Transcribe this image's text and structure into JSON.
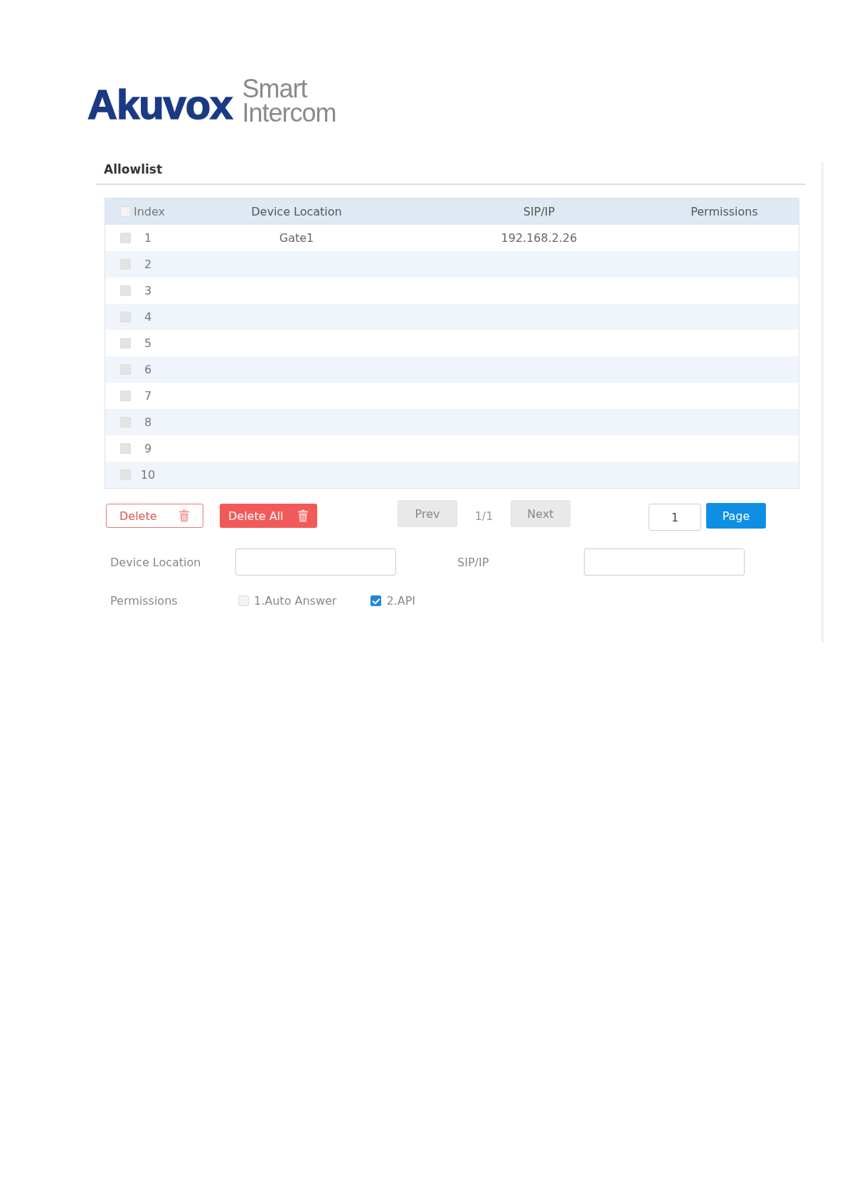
{
  "logo": {
    "brand": "Akuvox",
    "tagline": [
      "Smart",
      "Intercom"
    ]
  },
  "title": "Allowlist",
  "table": {
    "select_all": {
      "checked": false
    },
    "columns": [
      "Index",
      "Device Location",
      "SIP/IP",
      "Permissions"
    ],
    "rows": [
      {
        "index": "1",
        "location": "Gate1",
        "sip": "192.168.2.26",
        "selected": false
      },
      {
        "index": "2",
        "selected": false
      },
      {
        "index": "3",
        "selected": false
      },
      {
        "index": "4",
        "selected": false
      },
      {
        "index": "5",
        "selected": false
      },
      {
        "index": "6",
        "selected": false
      },
      {
        "index": "7",
        "selected": false
      },
      {
        "index": "8",
        "selected": false
      },
      {
        "index": "9",
        "selected": false
      },
      {
        "index": "10",
        "selected": false
      }
    ]
  },
  "actions": {
    "delete": "Delete",
    "delete_all": "Delete All",
    "prev": "Prev",
    "page_info": "1/1",
    "next": "Next",
    "page_value": "1",
    "page": "Page"
  },
  "form": {
    "location_label": "Device Location",
    "sip_label": "SIP/IP",
    "permissions_label": "Permissions",
    "permissions": [
      {
        "label": "1.Auto Answer",
        "checked": false
      },
      {
        "label": "2.API",
        "checked": true
      }
    ]
  }
}
